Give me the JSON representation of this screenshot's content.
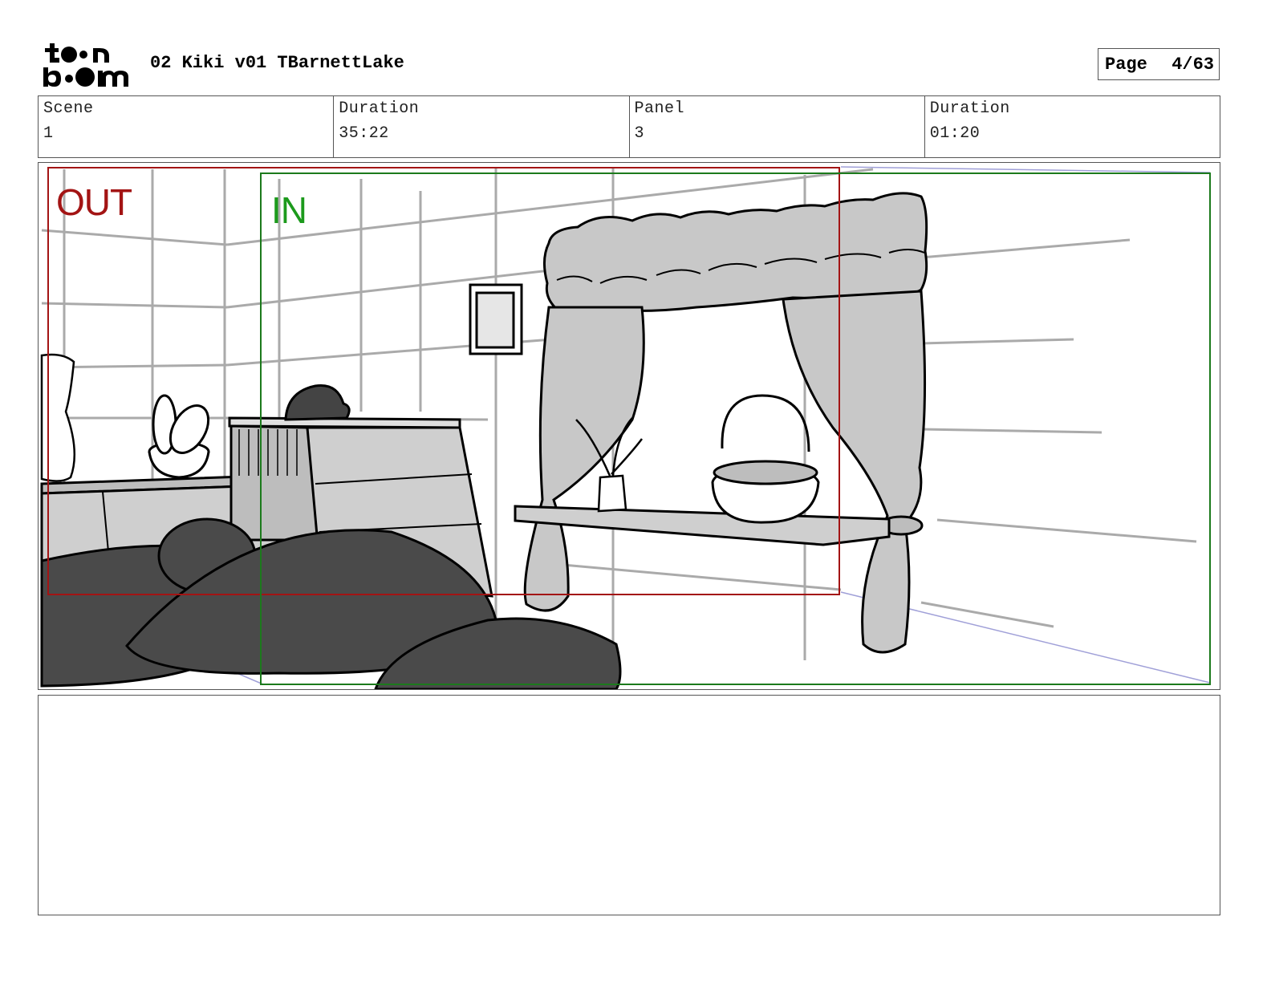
{
  "header": {
    "logo_alt": "toon boom",
    "title": "02 Kiki v01 TBarnettLake",
    "page_label": "Page",
    "page_value": "4/63"
  },
  "info": [
    {
      "label": "Scene",
      "value": "1"
    },
    {
      "label": "Duration",
      "value": "35:22"
    },
    {
      "label": "Panel",
      "value": "3"
    },
    {
      "label": "Duration",
      "value": "01:20"
    }
  ],
  "panel": {
    "out_label": "OUT",
    "in_label": "IN",
    "out_color": "#a31414",
    "in_color": "#1c9a1c"
  },
  "notes": {
    "text": ""
  }
}
